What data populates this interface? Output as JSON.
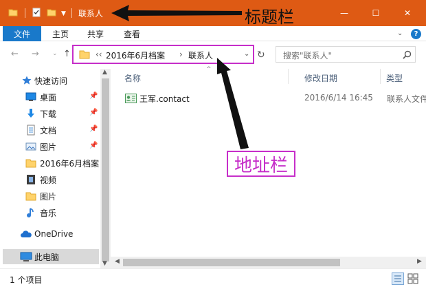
{
  "titlebar": {
    "window_title": "联系人",
    "annotation": "标题栏",
    "minimize_glyph": "—",
    "maximize_glyph": "☐",
    "close_glyph": "✕"
  },
  "ribbon": {
    "file_tab": "文件",
    "tabs": [
      "主页",
      "共享",
      "查看"
    ],
    "help_glyph": "?",
    "collapse_glyph": "⌄"
  },
  "navigation": {
    "back_glyph": "←",
    "forward_glyph": "→",
    "recent_glyph": "⌄",
    "up_glyph": "↑",
    "address_prefix": "‹‹",
    "breadcrumb": [
      "2016年6月档案",
      "联系人"
    ],
    "breadcrumb_sep": "›",
    "dropdown_glyph": "⌄",
    "refresh_glyph": "↻",
    "search_placeholder": "搜索\"联系人\""
  },
  "sidebar": {
    "quick_access": "快速访问",
    "items": [
      {
        "label": "桌面",
        "icon": "desktop-icon",
        "pinned": true
      },
      {
        "label": "下载",
        "icon": "download-icon",
        "pinned": true
      },
      {
        "label": "文档",
        "icon": "document-icon",
        "pinned": true
      },
      {
        "label": "图片",
        "icon": "pictures-icon",
        "pinned": true
      },
      {
        "label": "2016年6月档案",
        "icon": "folder-icon",
        "pinned": false
      },
      {
        "label": "视频",
        "icon": "video-icon",
        "pinned": false
      },
      {
        "label": "图片",
        "icon": "folder-icon",
        "pinned": false
      },
      {
        "label": "音乐",
        "icon": "music-icon",
        "pinned": false
      }
    ],
    "onedrive": "OneDrive",
    "this_pc": "此电脑",
    "pin_glyph": "📌"
  },
  "content": {
    "columns": {
      "name": "名称",
      "date": "修改日期",
      "type": "类型"
    },
    "sort_glyph": "^",
    "files": [
      {
        "name": "王军.contact",
        "date": "2016/6/14 16:45",
        "type": "联系人文件"
      }
    ]
  },
  "annotations": {
    "address_bar": "地址栏"
  },
  "statusbar": {
    "item_count": "1 个项目"
  },
  "colors": {
    "titlebar": "#de5a14",
    "file_tab": "#1979ca",
    "annotation_magenta": "#c62ec9"
  }
}
